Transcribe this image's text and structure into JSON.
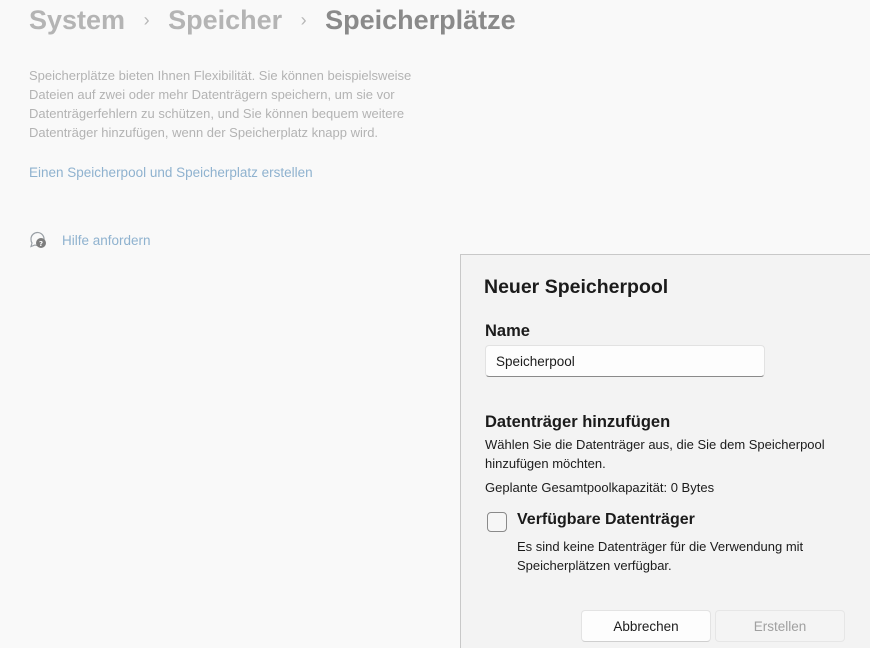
{
  "breadcrumb": {
    "items": [
      "System",
      "Speicher",
      "Speicherplätze"
    ],
    "separator": "›"
  },
  "page": {
    "description": "Speicherplätze bieten Ihnen Flexibilität. Sie können beispielsweise Dateien auf zwei oder mehr Datenträgern speichern, um sie vor Datenträgerfehlern zu schützen, und Sie können bequem weitere Datenträger hinzufügen, wenn der Speicherplatz knapp wird.",
    "create_link": "Einen Speicherpool und Speicherplatz erstellen",
    "help_link": "Hilfe anfordern",
    "help_icon": "help-chat-icon"
  },
  "dialog": {
    "title": "Neuer Speicherpool",
    "name_label": "Name",
    "name_value": "Speicherpool",
    "section_title": "Datenträger hinzufügen",
    "section_desc": "Wählen Sie die Datenträger aus, die Sie dem Speicherpool hinzufügen möchten.",
    "capacity": "Geplante Gesamtpoolkapazität: 0 Bytes",
    "checkbox_label": "Verfügbare Datenträger",
    "checkbox_checked": false,
    "checkbox_desc": "Es sind keine Datenträger für die Verwendung mit Speicherplätzen verfügbar.",
    "cancel_label": "Abbrechen",
    "create_label": "Erstellen"
  },
  "colors": {
    "link": "#8fb2cf",
    "dialog_bg": "#f3f3f3",
    "page_bg": "#f9f9f9"
  }
}
